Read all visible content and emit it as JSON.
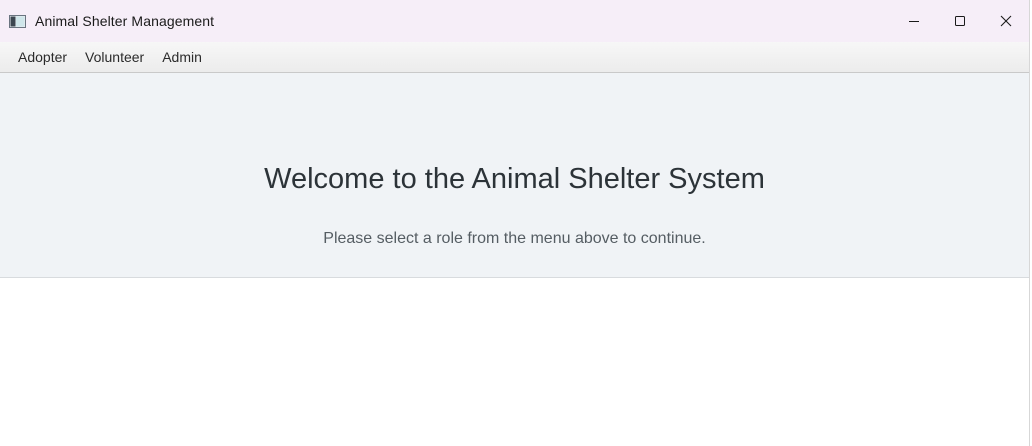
{
  "window": {
    "title": "Animal Shelter Management",
    "icon": "app-window-icon",
    "controls": {
      "minimize_icon": "minimize-icon",
      "maximize_icon": "maximize-icon",
      "close_icon": "close-icon"
    }
  },
  "menubar": {
    "items": [
      {
        "label": "Adopter"
      },
      {
        "label": "Volunteer"
      },
      {
        "label": "Admin"
      }
    ]
  },
  "hero": {
    "title": "Welcome to the Animal Shelter System",
    "subtitle": "Please select a role from the menu above to continue."
  },
  "colors": {
    "titlebar_bg": "#f6eef8",
    "menubar_bg": "#efefef",
    "hero_bg": "#f0f3f6",
    "content_bg": "#ffffff",
    "title_text": "#2c3338",
    "subtitle_text": "#555d63"
  }
}
